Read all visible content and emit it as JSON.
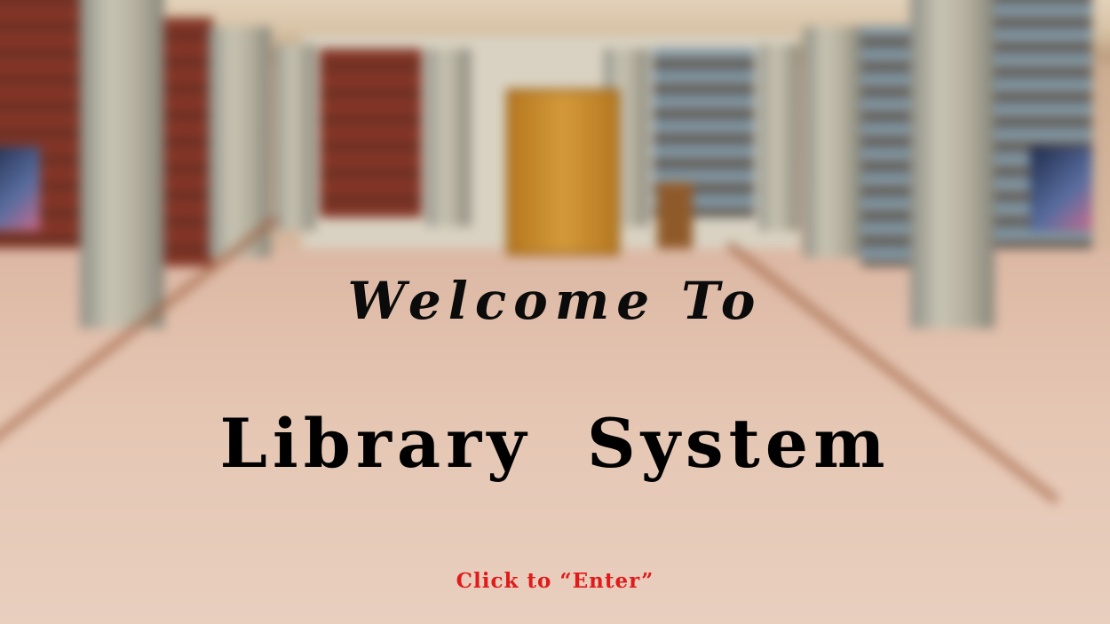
{
  "splash": {
    "welcome_text": "Welcome To",
    "title_text": "Library  System",
    "enter_link_text": "Click to “Enter”"
  },
  "colors": {
    "welcome": "#0b0b0b",
    "title": "#000000",
    "enter_link": "#e11b1b"
  }
}
